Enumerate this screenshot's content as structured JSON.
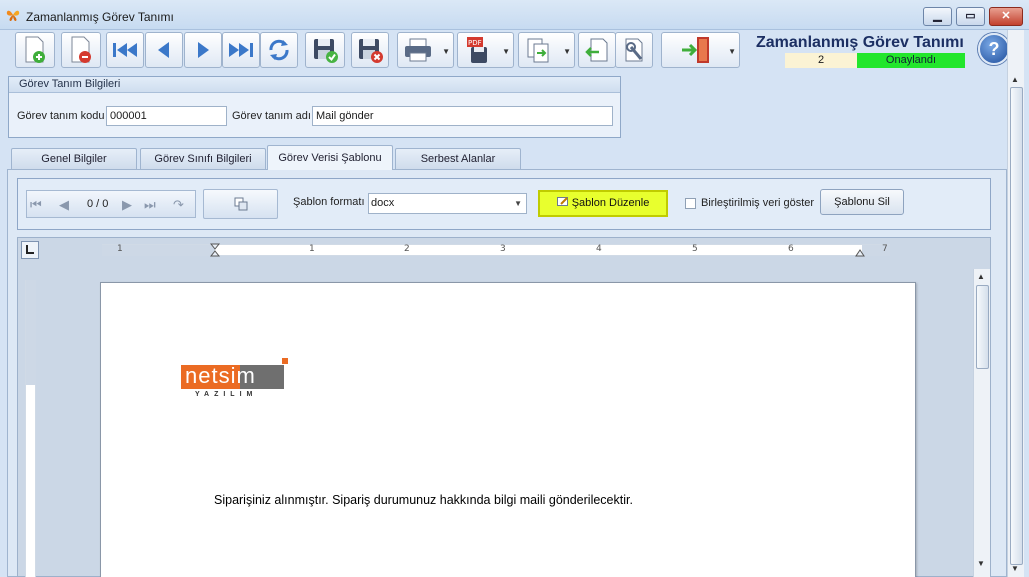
{
  "window": {
    "title": "Zamanlanmış Görev Tanımı",
    "min_label": "▁",
    "max_label": "▭",
    "close_label": "✕"
  },
  "toolbar": {
    "icons": [
      "new-document-icon",
      "delete-document-icon",
      "first-record-icon",
      "previous-record-icon",
      "next-record-icon",
      "last-record-icon",
      "refresh-icon",
      "save-icon",
      "save-close-icon",
      "print-icon",
      "pdf-export-icon",
      "copy-icon",
      "import-icon",
      "settings-icon",
      "exit-icon"
    ]
  },
  "header": {
    "title": "Zamanlanmış Görev Tanımı",
    "number": "2",
    "status": "Onaylandı",
    "status_color": "#22e62c",
    "help_label": "?"
  },
  "group": {
    "title": "Görev Tanım Bilgileri",
    "code_label": "Görev tanım kodu",
    "code_value": "000001",
    "name_label": "Görev tanım adı",
    "name_value": "Mail gönder"
  },
  "tabs": [
    {
      "label": "Genel Bilgiler"
    },
    {
      "label": "Görev Sınıfı Bilgileri"
    },
    {
      "label": "Görev Verisi Şablonu"
    },
    {
      "label": "Serbest Alanlar"
    }
  ],
  "active_tab": "Görev Verisi Şablonu",
  "template": {
    "nav_count": "0 / 0",
    "format_label": "Şablon formatı",
    "format_value": "docx",
    "edit_label": "Şablon Düzenle",
    "merged_label": "Birleştirilmiş veri göster",
    "merged_checked": false,
    "delete_label": "Şablonu Sil"
  },
  "ruler": {
    "numbers": [
      "1",
      "1",
      "2",
      "3",
      "4",
      "5",
      "6",
      "7"
    ]
  },
  "document": {
    "logo_text": "netsim",
    "logo_sub": "YAZILIM",
    "logo_color": "#eb6b23",
    "body": "Siparişiniz alınmıştır. Sipariş durumunuz hakkında bilgi maili gönderilecektir."
  }
}
